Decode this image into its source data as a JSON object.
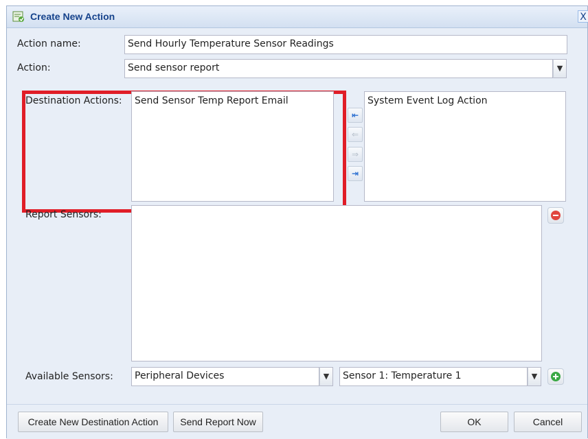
{
  "dialog": {
    "title": "Create New Action",
    "close_label": "X"
  },
  "form": {
    "action_name_label": "Action name:",
    "action_name_value": "Send Hourly Temperature Sensor Readings",
    "action_label": "Action:",
    "action_value": "Send sensor report",
    "destination_label": "Destination Actions:",
    "destination_selected": [
      "Send Sensor Temp Report Email"
    ],
    "destination_available": [
      "System Event Log Action"
    ],
    "report_sensors_label": "Report Sensors:",
    "available_sensors_label": "Available Sensors:",
    "sensor_group_value": "Peripheral Devices",
    "sensor_value": "Sensor 1: Temperature 1"
  },
  "footer": {
    "create_dest_label": "Create New Destination Action",
    "send_now_label": "Send Report Now",
    "ok_label": "OK",
    "cancel_label": "Cancel"
  },
  "colors": {
    "highlight": "#e01d27",
    "title_text": "#15428b",
    "remove_button": "#e0453f",
    "add_button": "#3aa845"
  }
}
